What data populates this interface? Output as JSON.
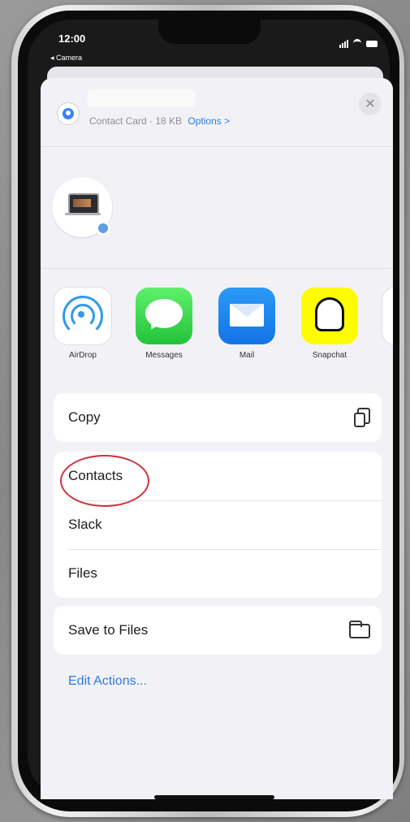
{
  "status_bar": {
    "time": "12:00",
    "back_label": "◂ Camera"
  },
  "share_sheet": {
    "header": {
      "subtitle": "Contact Card · 18 KB",
      "options_label": "Options >",
      "close_label": "✕"
    },
    "apps": [
      {
        "label": "AirDrop",
        "icon": "airdrop-icon"
      },
      {
        "label": "Messages",
        "icon": "messages-icon"
      },
      {
        "label": "Mail",
        "icon": "mail-icon"
      },
      {
        "label": "Snapchat",
        "icon": "snapchat-icon"
      }
    ],
    "actions_group1": [
      {
        "label": "Copy",
        "icon": "copy-icon"
      }
    ],
    "actions_group2": [
      {
        "label": "Contacts"
      },
      {
        "label": "Slack"
      },
      {
        "label": "Files"
      }
    ],
    "actions_group3": [
      {
        "label": "Save to Files",
        "icon": "folder-icon"
      }
    ],
    "edit_actions_label": "Edit Actions..."
  },
  "colors": {
    "accent": "#2f7ae5",
    "annotation": "#d0303a"
  }
}
